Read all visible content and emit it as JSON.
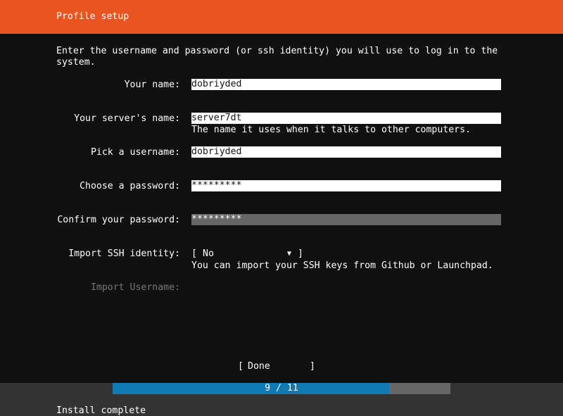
{
  "header": {
    "title": "Profile setup"
  },
  "intro": "Enter the username and password (or ssh identity) you will use to log in to the system.",
  "form": {
    "name": {
      "label": "Your name:",
      "value": "dobriyded"
    },
    "server": {
      "label": "Your server's name:",
      "value": "server7dt",
      "hint": "The name it uses when it talks to other computers."
    },
    "username": {
      "label": "Pick a username:",
      "value": "dobriyded"
    },
    "password": {
      "label": "Choose a password:",
      "value": "*********"
    },
    "confirm": {
      "label": "Confirm your password:",
      "value": "*********"
    },
    "ssh": {
      "label": "Import SSH identity:",
      "bracket_open": "[",
      "value": "No",
      "arrow": "▼",
      "bracket_close": "]",
      "hint": "You can import your SSH keys from Github or Launchpad."
    },
    "import_username": {
      "label": "Import Username:"
    }
  },
  "done_button": {
    "bracket_open": "[",
    "label": "Done",
    "bracket_close": "]"
  },
  "progress": {
    "text": "9 / 11",
    "current": 9,
    "total": 11
  },
  "footer": {
    "status": "Install complete"
  },
  "colors": {
    "accent": "#e95420",
    "background": "#111111",
    "progress_fill": "#0e79b2",
    "progress_track": "#666666",
    "field_bg": "#ffffff",
    "field_focused_bg": "#666666",
    "dim_text": "#767676"
  }
}
